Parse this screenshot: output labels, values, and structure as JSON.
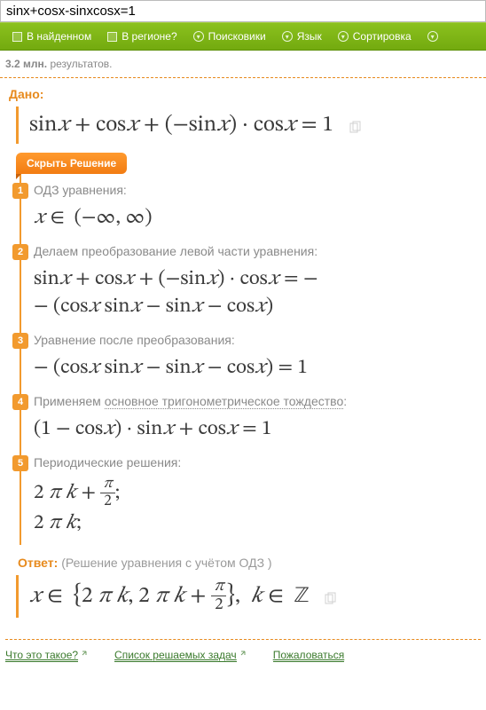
{
  "search": {
    "value": "sinx+cosx-sinxcosx=1"
  },
  "nav": {
    "found": "В найденном",
    "region": "В регионе?",
    "engines": "Поисковики",
    "language": "Язык",
    "sort": "Сортировка"
  },
  "results": {
    "count": "3.2 млн.",
    "label": "результатов."
  },
  "given_label": "Дано:",
  "given_formula": "sin𝑥 + cos𝑥 + (−sin𝑥) · cos𝑥 = 1",
  "hide_solution": "Скрыть Решение",
  "steps": [
    {
      "n": "1",
      "text": "ОДЗ уравнения:",
      "formula_a": "𝑥 ∈  (−∞, ∞)"
    },
    {
      "n": "2",
      "text": "Делаем преобразование левой части уравнения:",
      "formula_a": "sin𝑥 + cos𝑥 + (−sin𝑥) · cos𝑥 = −",
      "formula_b": "− (cos𝑥 sin𝑥 − sin𝑥 − cos𝑥)"
    },
    {
      "n": "3",
      "text": "Уравнение после преобразования:",
      "formula_a": "− (cos𝑥 sin𝑥 − sin𝑥 − cos𝑥) = 1"
    },
    {
      "n": "4",
      "text_pre": "Применяем ",
      "text_link": "основное тригонометрическое тождество",
      "text_post": ":",
      "formula_a": "(1 − cos𝑥) · sin𝑥 + cos𝑥 = 1"
    },
    {
      "n": "5",
      "text": "Периодические решения:",
      "formula_a": "2 π 𝑘 + __FRAC_PI_2__;",
      "formula_b": "2 π 𝑘;"
    }
  ],
  "answer": {
    "label": "Ответ:",
    "note": "(Решение уравнения с учётом ОДЗ )",
    "formula": "𝑥 ∈  {2 π 𝑘, 2 π 𝑘 + __FRAC_PI_2__},  𝑘 ∈  ℤ"
  },
  "footer": {
    "what": "Что это такое?",
    "list": "Список решаемых задач",
    "complain": "Пожаловаться"
  }
}
